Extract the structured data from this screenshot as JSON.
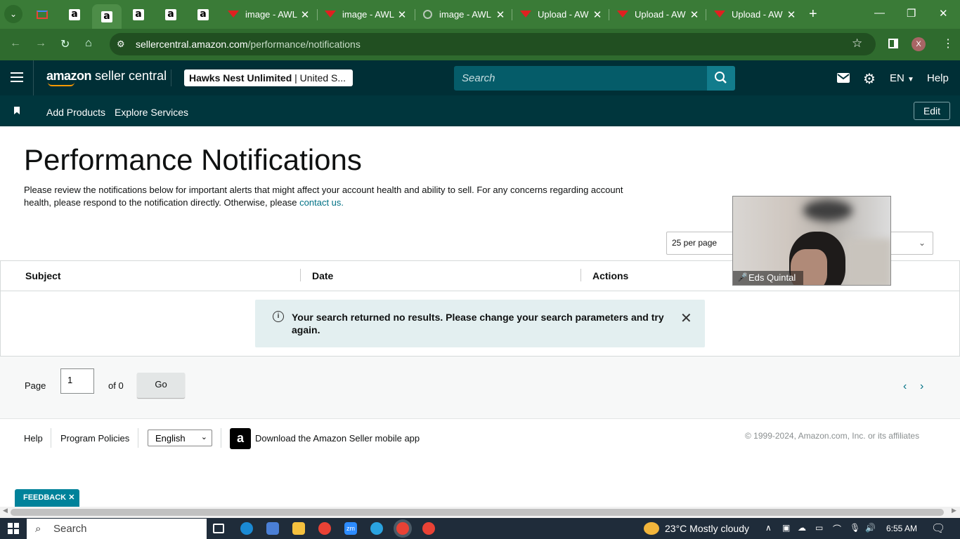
{
  "browser": {
    "tabs": [
      {
        "label": "",
        "icon": "gmail-icon"
      },
      {
        "label": "",
        "icon": "amazon-icon"
      },
      {
        "label": "",
        "icon": "amazon-icon",
        "active": true
      },
      {
        "label": "",
        "icon": "amazon-icon"
      },
      {
        "label": "",
        "icon": "amazon-icon"
      },
      {
        "label": "",
        "icon": "amazon-icon"
      },
      {
        "label": "image - AWL",
        "icon": "awl-icon"
      },
      {
        "label": "image - AWL",
        "icon": "awl-icon"
      },
      {
        "label": "image - AWL",
        "icon": "globe-icon"
      },
      {
        "label": "Upload - AW",
        "icon": "awl-icon"
      },
      {
        "label": "Upload - AW",
        "icon": "awl-icon"
      },
      {
        "label": "Upload - AW",
        "icon": "awl-icon"
      }
    ],
    "url_host": "sellercentral.amazon.com",
    "url_path": "/performance/notifications",
    "profile_initial": "X"
  },
  "header": {
    "logo_bold": "amazon",
    "logo_rest": " seller central",
    "store_name": "Hawks Nest Unlimited",
    "store_region": " | United S...",
    "search_placeholder": "Search",
    "language": "EN",
    "help": "Help"
  },
  "nav": {
    "links": [
      "Add Products",
      "Explore Services"
    ],
    "edit": "Edit"
  },
  "page": {
    "title": "Performance Notifications",
    "description": "Please review the notifications below for important alerts that might affect your account health and ability to sell. For any concerns regarding account health, please respond to the notification directly. Otherwise, please ",
    "contact_link": "contact us.",
    "per_page": "25 per page",
    "columns": [
      "Subject",
      "Date",
      "Actions"
    ],
    "alert": "Your search returned no results. Please change your search parameters and try again.",
    "pager": {
      "page_label": "Page",
      "page_value": "1",
      "of_label": "of 0",
      "go": "Go"
    }
  },
  "footer": {
    "help": "Help",
    "policies": "Program Policies",
    "language": "English",
    "app_text": "Download the Amazon Seller mobile app",
    "copyright": "© 1999-2024, Amazon.com, Inc. or its affiliates",
    "feedback": "FEEDBACK"
  },
  "video_overlay": {
    "name": "Eds Quintal"
  },
  "taskbar": {
    "search": "Search",
    "weather": "23°C  Mostly cloudy",
    "time": "6:55 AM"
  },
  "colors": {
    "header_bg": "#002f36",
    "accent": "#007185",
    "alert_bg": "#e3eff0",
    "browser_green": "#3a7b37"
  }
}
